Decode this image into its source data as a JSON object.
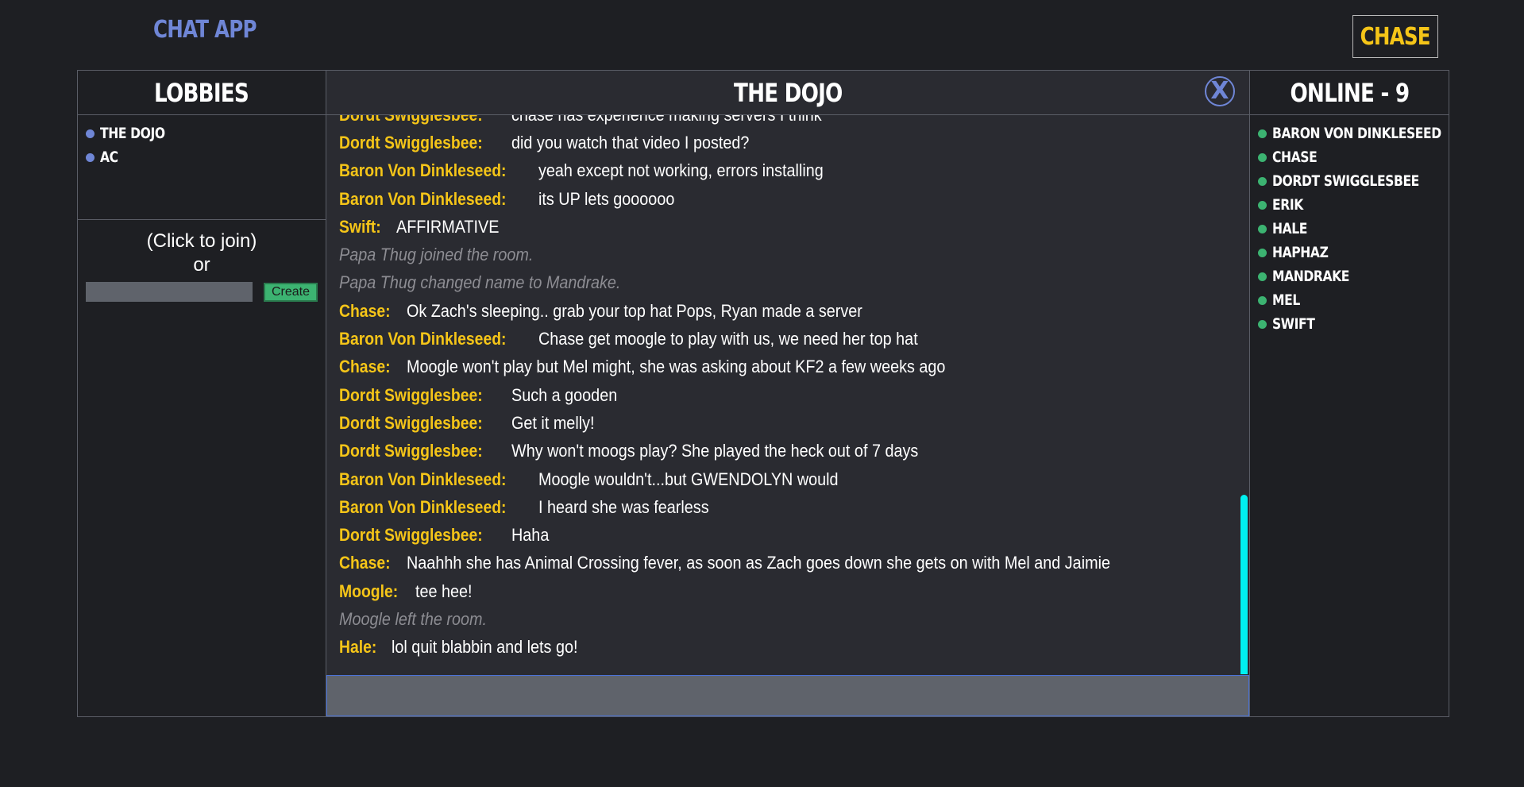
{
  "app": {
    "title": "CHAT APP",
    "current_user": "CHASE"
  },
  "lobbies": {
    "header": "LOBBIES",
    "items": [
      {
        "label": "THE DOJO"
      },
      {
        "label": "AC"
      }
    ],
    "join_hint": "(Click to join)",
    "or_label": "or",
    "create_placeholder": "",
    "create_label": "Create"
  },
  "chat": {
    "header": "THE DOJO",
    "close_label": "X",
    "input_placeholder": "",
    "messages": [
      {
        "author": "Dordt Swigglesbee:",
        "text": "chase has experience making servers I think"
      },
      {
        "author": "Dordt Swigglesbee:",
        "text": "did you watch that video I posted?"
      },
      {
        "author": "Baron Von Dinkleseed:",
        "text": "yeah except not working, errors installing"
      },
      {
        "author": "Baron Von Dinkleseed:",
        "text": "its UP lets goooooo"
      },
      {
        "author": "Swift:",
        "text": "AFFIRMATIVE"
      },
      {
        "author": "",
        "text": "Papa Thug joined the room.",
        "system": true
      },
      {
        "author": "",
        "text": "Papa Thug changed name to Mandrake.",
        "system": true
      },
      {
        "author": "Chase:",
        "text": "Ok Zach's sleeping.. grab your top hat Pops, Ryan made a server"
      },
      {
        "author": "Baron Von Dinkleseed:",
        "text": "Chase get moogle to play with us, we need her top hat"
      },
      {
        "author": "Chase:",
        "text": "Moogle won't play but Mel might, she was asking about KF2 a few weeks ago"
      },
      {
        "author": "Dordt Swigglesbee:",
        "text": "Such a gooden"
      },
      {
        "author": "Dordt Swigglesbee:",
        "text": "Get it melly!"
      },
      {
        "author": "Dordt Swigglesbee:",
        "text": "Why won't moogs play? She played the heck out of 7 days"
      },
      {
        "author": "Baron Von Dinkleseed:",
        "text": "Moogle wouldn't...but GWENDOLYN would"
      },
      {
        "author": "Baron Von Dinkleseed:",
        "text": "I heard she was fearless"
      },
      {
        "author": "Dordt Swigglesbee:",
        "text": "Haha"
      },
      {
        "author": "Chase:",
        "text": "Naahhh she has Animal Crossing fever, as soon as Zach goes down she gets on with Mel and Jaimie"
      },
      {
        "author": "Moogle:",
        "text": "tee hee!"
      },
      {
        "author": "",
        "text": "Moogle left the room.",
        "system": true
      },
      {
        "author": "Hale:",
        "text": "lol quit blabbin and lets go!"
      }
    ]
  },
  "online": {
    "header": "ONLINE - 9",
    "users": [
      {
        "label": "BARON VON DINKLESEED"
      },
      {
        "label": "CHASE"
      },
      {
        "label": "DORDT SWIGGLESBEE"
      },
      {
        "label": "ERIK"
      },
      {
        "label": "HALE"
      },
      {
        "label": "HAPHAZ"
      },
      {
        "label": "MANDRAKE"
      },
      {
        "label": "MEL"
      },
      {
        "label": "SWIFT"
      }
    ]
  },
  "colors": {
    "background": "#1e1f23",
    "panel": "#2a2b31",
    "accent": "#6f86d6",
    "author": "#f5c518",
    "online": "#3cb371",
    "scrollbar": "#00f0f0"
  }
}
